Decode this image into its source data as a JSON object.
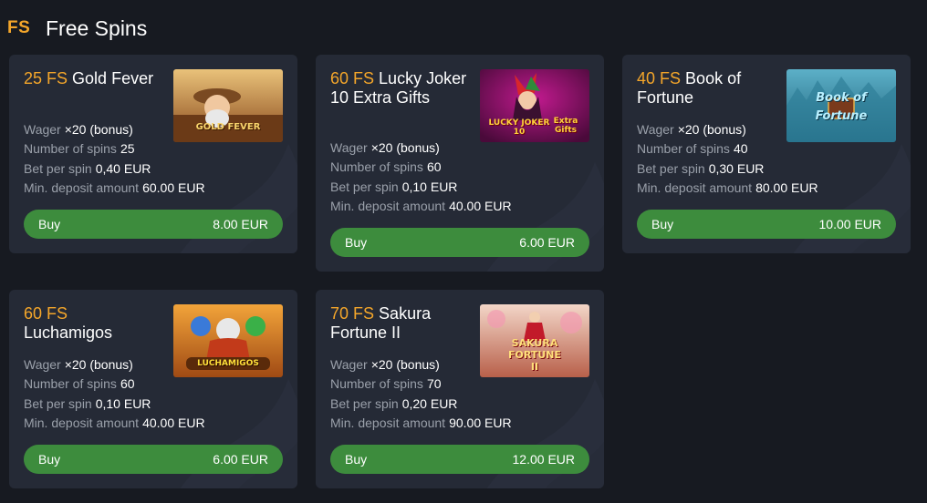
{
  "header": {
    "logo_text": "FS",
    "title": "Free Spins"
  },
  "labels": {
    "wager": "Wager",
    "spins": "Number of spins",
    "bet": "Bet per spin",
    "deposit": "Min. deposit amount",
    "buy": "Buy"
  },
  "cards": [
    {
      "fs": "25 FS",
      "name": "Gold Fever",
      "wager": "×20 (bonus)",
      "spins": "25",
      "bet": "0,40 EUR",
      "deposit": "60.00 EUR",
      "price": "8.00 EUR",
      "thumb_text": "GOLD FEVER"
    },
    {
      "fs": "60 FS",
      "name": "Lucky Joker 10 Extra Gifts",
      "wager": "×20 (bonus)",
      "spins": "60",
      "bet": "0,10 EUR",
      "deposit": "40.00 EUR",
      "price": "6.00 EUR",
      "thumb_text": "LUCKY JOKER 10",
      "thumb_sub": "Extra Gifts"
    },
    {
      "fs": "40 FS",
      "name": "Book of Fortune",
      "wager": "×20 (bonus)",
      "spins": "40",
      "bet": "0,30 EUR",
      "deposit": "80.00 EUR",
      "price": "10.00 EUR",
      "thumb_text": "Book of Fortune"
    },
    {
      "fs": "60 FS",
      "name": "Luchamigos",
      "wager": "×20 (bonus)",
      "spins": "60",
      "bet": "0,10 EUR",
      "deposit": "40.00 EUR",
      "price": "6.00 EUR",
      "thumb_text": "LUCHAMIGOS"
    },
    {
      "fs": "70 FS",
      "name": "Sakura Fortune II",
      "wager": "×20 (bonus)",
      "spins": "70",
      "bet": "0,20 EUR",
      "deposit": "90.00 EUR",
      "price": "12.00 EUR",
      "thumb_text": "SAKURA FORTUNE",
      "thumb_sub": "II"
    }
  ],
  "colors": {
    "accent": "#f4a62a",
    "buy_button": "#3d8c3d",
    "card_bg": "#252a36",
    "page_bg": "#171a21"
  }
}
